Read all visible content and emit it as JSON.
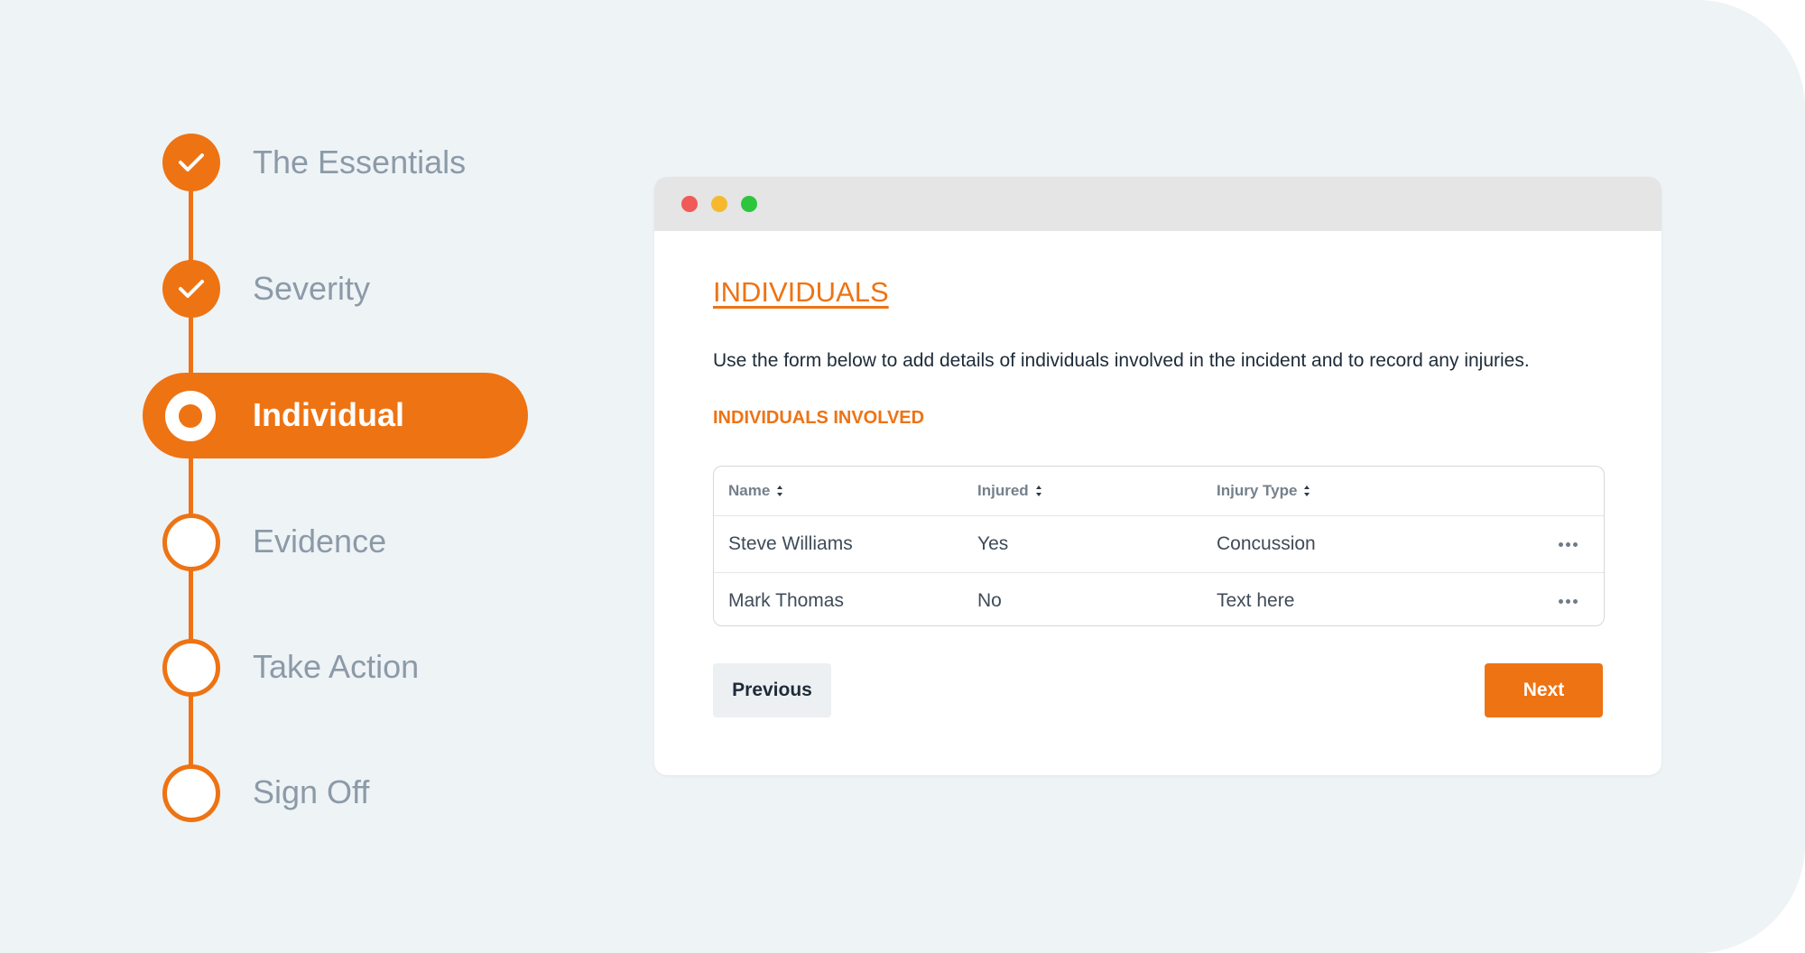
{
  "colors": {
    "accent": "#ee7313",
    "background": "#eef3f6",
    "muted_text": "#8c9aa8",
    "dark_text": "#1e2b39",
    "traffic_red": "#f05a57",
    "traffic_yellow": "#f6b92e",
    "traffic_green": "#2cc63d"
  },
  "steps": [
    {
      "label": "The Essentials",
      "state": "done",
      "icon": "check-icon"
    },
    {
      "label": "Severity",
      "state": "done",
      "icon": "check-icon"
    },
    {
      "label": "Individual",
      "state": "current",
      "icon": "radio-dot-icon"
    },
    {
      "label": "Evidence",
      "state": "todo",
      "icon": "empty-circle-icon"
    },
    {
      "label": "Take Action",
      "state": "todo",
      "icon": "empty-circle-icon"
    },
    {
      "label": "Sign Off",
      "state": "todo",
      "icon": "empty-circle-icon"
    }
  ],
  "window": {
    "title": "INDIVIDUALS",
    "intro": "Use the form below to add details of individuals involved in the incident and to record any injuries.",
    "subhead": "INDIVIDUALS INVOLVED"
  },
  "table": {
    "columns": [
      "Name",
      "Injured",
      "Injury Type"
    ],
    "sort_icon": "sort-icon",
    "row_action_icon": "more-horizontal-icon",
    "rows": [
      [
        "Steve Williams",
        "Yes",
        "Concussion"
      ],
      [
        "Mark Thomas",
        "No",
        "Text here"
      ]
    ]
  },
  "buttons": {
    "previous": "Previous",
    "next": "Next"
  }
}
